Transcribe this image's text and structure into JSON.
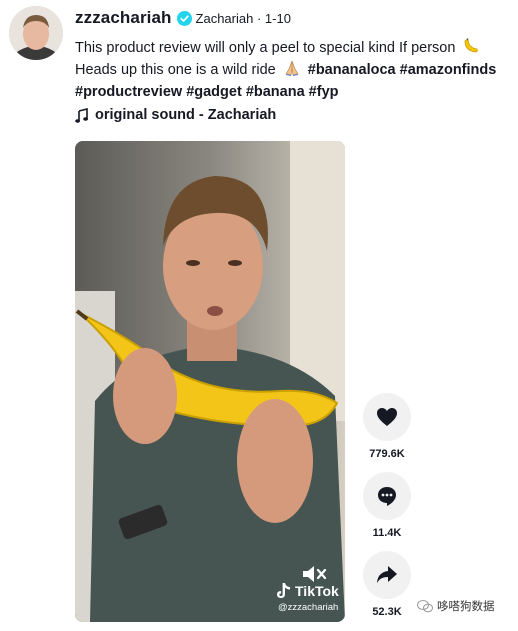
{
  "post": {
    "username": "zzzachariah",
    "nickname": "Zachariah",
    "date": "1-10",
    "caption_line1": "This product review will only a peel to special kind If person",
    "caption_line2_text": "Heads up this one is a wild ride",
    "caption_line2_tags": "#bananaloca #amazonfinds",
    "caption_line3_tags": "#productreview #gadget #banana #fyp",
    "sound": "original sound - Zachariah"
  },
  "video": {
    "brand": "TikTok",
    "handle": "@zzzachariah"
  },
  "actions": {
    "likes": "779.6K",
    "comments": "11.4K",
    "shares": "52.3K"
  },
  "watermark": {
    "text": "哆嗒狗数据"
  },
  "icons": [
    "verified-icon",
    "music-note-icon",
    "heart-icon",
    "comment-icon",
    "share-icon",
    "mute-icon",
    "tiktok-logo-icon",
    "banana-emoji-icon",
    "praying-hands-emoji-icon",
    "watermark-icon"
  ],
  "colors": {
    "verified": "#20d5ec",
    "action_bg": "#f1f1f2",
    "text": "#161823"
  }
}
